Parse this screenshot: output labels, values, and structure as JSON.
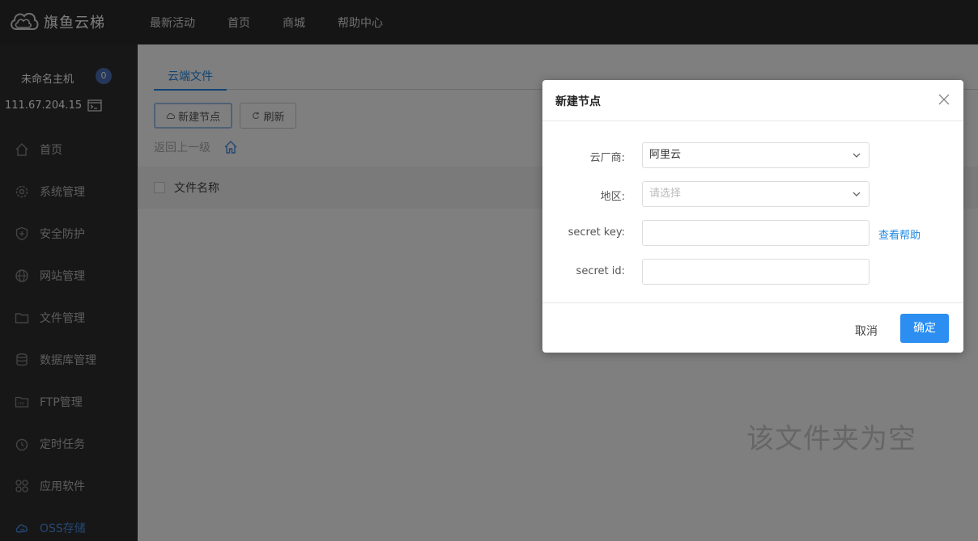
{
  "topbar": {
    "logo_text": "旗鱼云梯",
    "nav": [
      "最新活动",
      "首页",
      "商城",
      "帮助中心"
    ]
  },
  "sidebar": {
    "host_name": "未命名主机",
    "host_badge": "0",
    "host_ip": "111.67.204.15",
    "items": [
      {
        "label": "首页",
        "icon": "home-icon"
      },
      {
        "label": "系统管理",
        "icon": "gear-icon"
      },
      {
        "label": "安全防护",
        "icon": "shield-icon"
      },
      {
        "label": "网站管理",
        "icon": "globe-icon"
      },
      {
        "label": "文件管理",
        "icon": "folder-icon"
      },
      {
        "label": "数据库管理",
        "icon": "database-icon"
      },
      {
        "label": "FTP管理",
        "icon": "ftp-icon"
      },
      {
        "label": "定时任务",
        "icon": "clock-icon"
      },
      {
        "label": "应用软件",
        "icon": "apps-icon"
      },
      {
        "label": "OSS存储",
        "icon": "cloud-storage-icon"
      }
    ],
    "active_item": "OSS存储"
  },
  "main": {
    "tab": "云端文件",
    "new_node_button": "新建节点",
    "refresh_button": "刷新",
    "back_link": "返回上一级",
    "column_name": "文件名称",
    "empty_text": "该文件夹为空"
  },
  "dialog": {
    "title": "新建节点",
    "fields": {
      "provider_label": "云厂商:",
      "provider_value": "阿里云",
      "region_label": "地区:",
      "region_placeholder": "请选择",
      "secret_key_label": "secret key:",
      "secret_key_value": "",
      "secret_id_label": "secret id:",
      "secret_id_value": ""
    },
    "help_link": "查看帮助",
    "cancel_button": "取消",
    "ok_button": "确定"
  },
  "colors": {
    "topbar_bg": "#2b2b2b",
    "sidebar_bg": "#2e2e2e",
    "accent": "#2b8ef0",
    "active_menu": "#4a8fe7"
  }
}
